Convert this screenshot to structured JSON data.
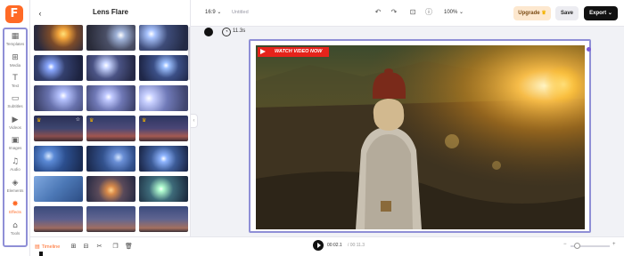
{
  "app": {
    "logo_letter": "F",
    "brand_color": "#ff6a26",
    "highlight_color": "#8f8fd6"
  },
  "sidebar": {
    "items": [
      {
        "label": "Templates",
        "icon": "template-icon"
      },
      {
        "label": "Media",
        "icon": "media-icon"
      },
      {
        "label": "Text",
        "icon": "text-icon"
      },
      {
        "label": "Subtitles",
        "icon": "subtitles-icon"
      },
      {
        "label": "Videos",
        "icon": "videos-icon"
      },
      {
        "label": "Images",
        "icon": "images-icon"
      },
      {
        "label": "Audio",
        "icon": "audio-icon"
      },
      {
        "label": "Elements",
        "icon": "elements-icon"
      },
      {
        "label": "Effects",
        "icon": "effects-icon",
        "active": true
      },
      {
        "label": "Tools",
        "icon": "tools-icon"
      }
    ]
  },
  "panel": {
    "title": "Lens Flare",
    "back_icon": "chevron-left-icon",
    "thumbnails": [
      {
        "premium": false
      },
      {
        "premium": false
      },
      {
        "premium": false
      },
      {
        "premium": false
      },
      {
        "premium": false
      },
      {
        "premium": false
      },
      {
        "premium": false
      },
      {
        "premium": false
      },
      {
        "premium": false
      },
      {
        "premium": true,
        "favorite": true
      },
      {
        "premium": true
      },
      {
        "premium": true
      },
      {
        "premium": false
      },
      {
        "premium": false
      },
      {
        "premium": false
      },
      {
        "premium": false
      },
      {
        "premium": false
      },
      {
        "premium": false
      },
      {
        "premium": false
      },
      {
        "premium": false
      },
      {
        "premium": false
      }
    ]
  },
  "topbar": {
    "aspect_ratio": "16:9",
    "project_name": "Untitled",
    "zoom": "100%",
    "upgrade_label": "Upgrade",
    "save_label": "Save",
    "export_label": "Export"
  },
  "subbar": {
    "duration": "11.3s"
  },
  "canvas": {
    "banner_text": "WATCH VIDEO NOW"
  },
  "timeline": {
    "label": "Timeline",
    "current_time": "00:02.1",
    "total_time": "00:11.3"
  }
}
